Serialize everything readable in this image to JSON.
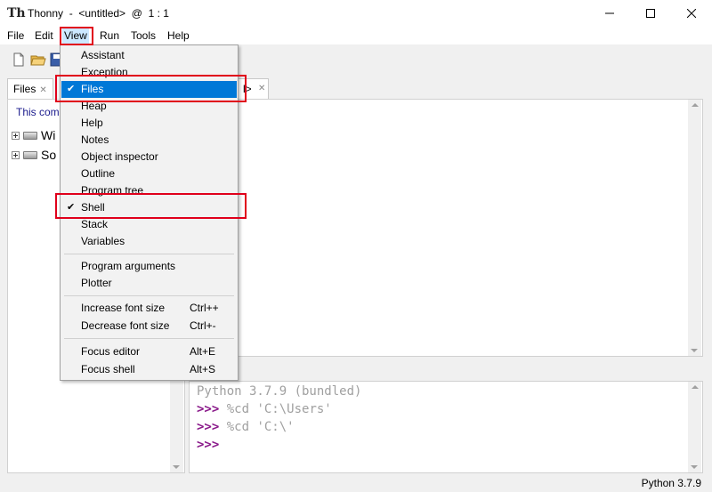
{
  "window": {
    "title": "Thonny  -  <untitled>  @  1 : 1",
    "app_icon": "Th"
  },
  "menubar": [
    "File",
    "Edit",
    "View",
    "Run",
    "Tools",
    "Help"
  ],
  "files_panel": {
    "tab_label": "Files",
    "info_text": "This com",
    "drives": [
      "Wi",
      "So"
    ]
  },
  "view_menu": {
    "items": [
      {
        "label": "Assistant"
      },
      {
        "label": "Exception"
      },
      {
        "label": "Files",
        "checked": true,
        "selected": true
      },
      {
        "label": "Heap"
      },
      {
        "label": "Help"
      },
      {
        "label": "Notes"
      },
      {
        "label": "Object inspector"
      },
      {
        "label": "Outline"
      },
      {
        "label": "Program tree"
      },
      {
        "label": "Shell",
        "checked": true
      },
      {
        "label": "Stack"
      },
      {
        "label": "Variables"
      },
      {
        "label": "Program arguments"
      },
      {
        "label": "Plotter"
      },
      {
        "label": "Increase font size",
        "accel": "Ctrl++"
      },
      {
        "label": "Decrease font size",
        "accel": "Ctrl+-"
      },
      {
        "label": "Focus editor",
        "accel": "Alt+E"
      },
      {
        "label": "Focus shell",
        "accel": "Alt+S"
      }
    ],
    "check_glyph": "✔"
  },
  "editor": {
    "tab_fragment": "l>"
  },
  "shell": {
    "banner": "Python 3.7.9 (bundled)",
    "prompt": ">>>",
    "lines": [
      " %cd 'C:\\Users'",
      " %cd 'C:\\'",
      ""
    ]
  },
  "status": {
    "text": "Python 3.7.9"
  },
  "colors": {
    "selection": "#0078d7",
    "highlight": "#e0001b",
    "prompt": "#8a1a8a",
    "info_text": "#1a1a8c"
  }
}
